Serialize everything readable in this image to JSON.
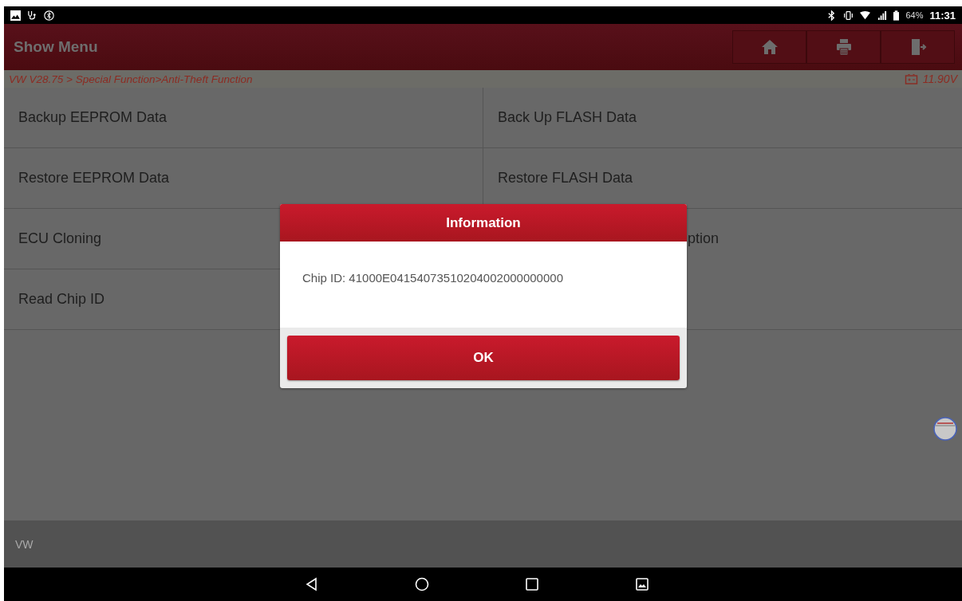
{
  "status_bar": {
    "battery": "64%",
    "time": "11:31"
  },
  "header": {
    "title": "Show Menu",
    "buttons": [
      {
        "kind": "home"
      },
      {
        "kind": "print"
      },
      {
        "kind": "exit"
      }
    ]
  },
  "breadcrumb": {
    "path": "VW V28.75 > Special Function>Anti-Theft Function",
    "voltage": "11.90V"
  },
  "menu": [
    {
      "label": "Backup EEPROM Data",
      "kind": "full"
    },
    {
      "label": "Back Up FLASH Data",
      "kind": "full"
    },
    {
      "label": "Restore EEPROM Data",
      "kind": "full"
    },
    {
      "label": "Restore FLASH Data",
      "kind": "full"
    },
    {
      "label": "ECU Cloning",
      "kind": "full"
    },
    {
      "label": "ption",
      "kind": "partial"
    },
    {
      "label": "Read Chip ID",
      "kind": "full"
    }
  ],
  "footer": {
    "label": "VW"
  },
  "dialog": {
    "title": "Information",
    "message": "Chip ID: 41000E04154073510204002000000000",
    "button": "OK"
  }
}
